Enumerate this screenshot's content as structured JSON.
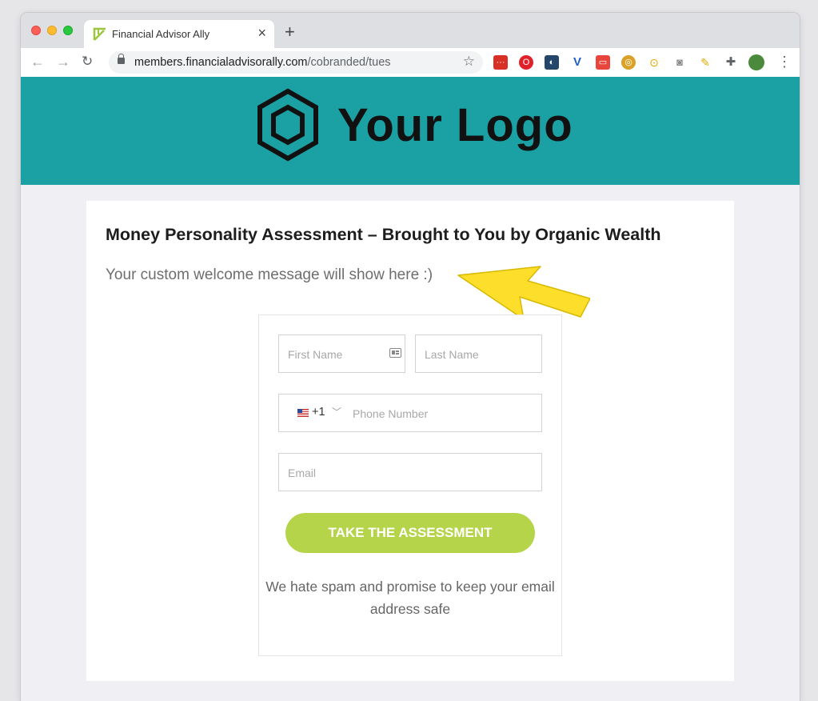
{
  "browser": {
    "tab_title": "Financial Advisor Ally",
    "tab_close": "×",
    "new_tab": "+",
    "url_host": "members.financialadvisorally.com",
    "url_path": "/cobranded/tues",
    "back": "←",
    "forward": "→",
    "reload": "↻",
    "bookmark_star": "☆",
    "menu": "⋮",
    "extensions": [
      "ext-red-icon",
      "opera-icon",
      "ext-blue-icon",
      "ext-v-icon",
      "ext-record-icon",
      "ext-globe-icon",
      "ext-magnify-icon",
      "camera-icon",
      "broom-icon",
      "puzzle-icon",
      "profile-avatar"
    ]
  },
  "banner": {
    "logo_text": "Your Logo",
    "color": "#1ba1a3"
  },
  "card": {
    "title": "Money Personality Assessment – Brought to You by Organic Wealth",
    "welcome": "Your custom welcome message will show here :)"
  },
  "form": {
    "first_name_placeholder": "First Name",
    "last_name_placeholder": "Last Name",
    "country_code": "+1",
    "phone_placeholder": "Phone Number",
    "email_placeholder": "Email",
    "submit_label": "TAKE THE ASSESSMENT",
    "submit_color": "#b5d44a",
    "disclaimer": "We hate spam and promise to keep your email address safe"
  }
}
